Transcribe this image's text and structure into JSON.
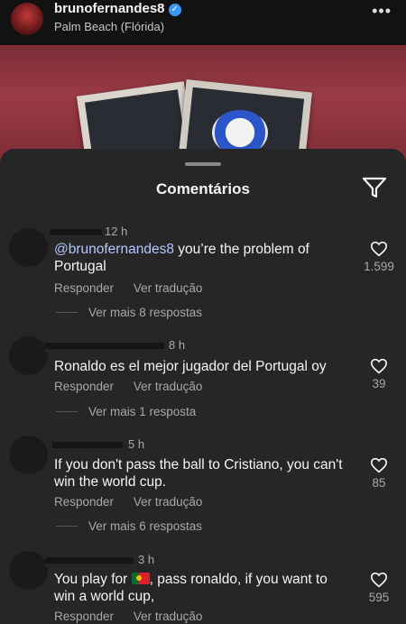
{
  "post": {
    "username": "brunofernandes8",
    "location": "Palm Beach (Flórida)",
    "avatar_icon": "profile-avatar",
    "verified_icon": "verified-badge-icon",
    "more_icon": "more-horizontal-icon"
  },
  "sheet": {
    "title": "Comentários",
    "filter_icon": "filter-icon"
  },
  "comments": [
    {
      "time": "12 h",
      "mention": "@brunofernandes8",
      "text": " you’re the problem of Portugal",
      "reply_label": "Responder",
      "translate_label": "Ver tradução",
      "replies_label": "Ver mais 8 respostas",
      "likes": "1.599"
    },
    {
      "time": "8 h",
      "text": "Ronaldo es el mejor jugador del Portugal oy",
      "reply_label": "Responder",
      "translate_label": "Ver tradução",
      "replies_label": "Ver mais 1 resposta",
      "likes": "39"
    },
    {
      "time": "5 h",
      "text": "If you don't pass the ball to Cristiano, you can't win the world cup.",
      "reply_label": "Responder",
      "translate_label": "Ver tradução",
      "replies_label": "Ver mais 6 respostas",
      "likes": "85"
    },
    {
      "time": "3 h",
      "text_before_flag": "You play for ",
      "flag_icon": "portugal-flag-icon",
      "text_after_flag": ", pass ronaldo, if you want to win a world cup,",
      "reply_label": "Responder",
      "translate_label": "Ver tradução",
      "likes": "595"
    }
  ],
  "colors": {
    "sheet_background": "#262626",
    "mention": "#b3c8ff",
    "verified": "#3897f0",
    "secondary_text": "#a8a8a8"
  }
}
